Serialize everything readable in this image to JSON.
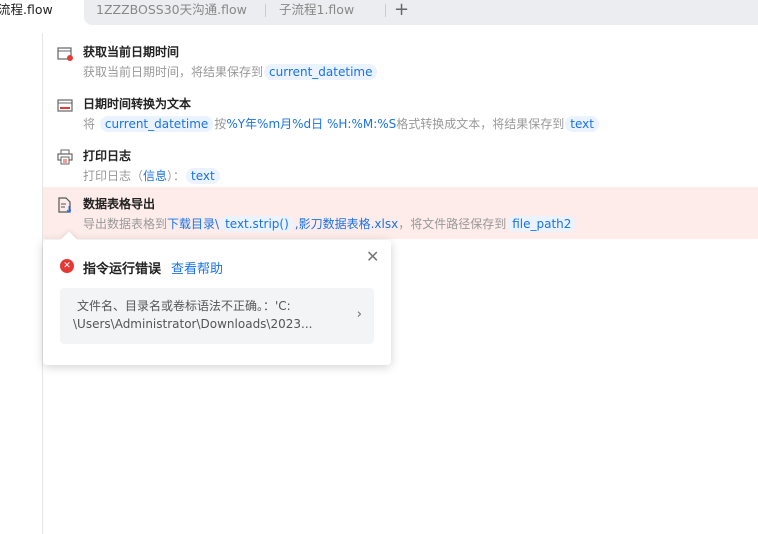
{
  "tabs": [
    {
      "label": "流程.flow",
      "active": true
    },
    {
      "label": "1ZZZBOSS30天沟通.flow"
    },
    {
      "label": "子流程1.flow"
    }
  ],
  "add_tab": "+",
  "steps": [
    {
      "icon": "calendar-clock-icon",
      "title": "获取当前日期时间",
      "desc": "获取当前日期时间，将结果保存到",
      "var": "current_datetime"
    },
    {
      "icon": "calendar-icon",
      "title": "日期时间转换为文本",
      "pre": "将",
      "var": "current_datetime",
      "mid": "按",
      "fmt": "%Y年%m月%d日 %H:%M:%S",
      "post": "格式转换成文本，将结果保存到",
      "var2": "text"
    },
    {
      "icon": "printer-icon",
      "title": "打印日志",
      "pre": "打印日志（",
      "link": "信息",
      "post": "）：",
      "var": "text"
    },
    {
      "icon": "file-export-icon",
      "title": "数据表格导出",
      "pre": "导出数据表格到",
      "link": "下载目录\\",
      "var": "text.strip()",
      "link2": ",影刀数据表格.xlsx",
      "post": "，将文件路径保存到",
      "var2": "file_path2"
    }
  ],
  "error": {
    "title": "指令运行错误",
    "help": "查看帮助",
    "line1": "文件名、目录名或卷标语法不正确。：'C:",
    "line2": "\\Users\\Administrator\\Downloads\\2023..."
  },
  "colors": {
    "accent": "#1a73e8",
    "error": "#e53935",
    "error_row": "#fdecea"
  }
}
